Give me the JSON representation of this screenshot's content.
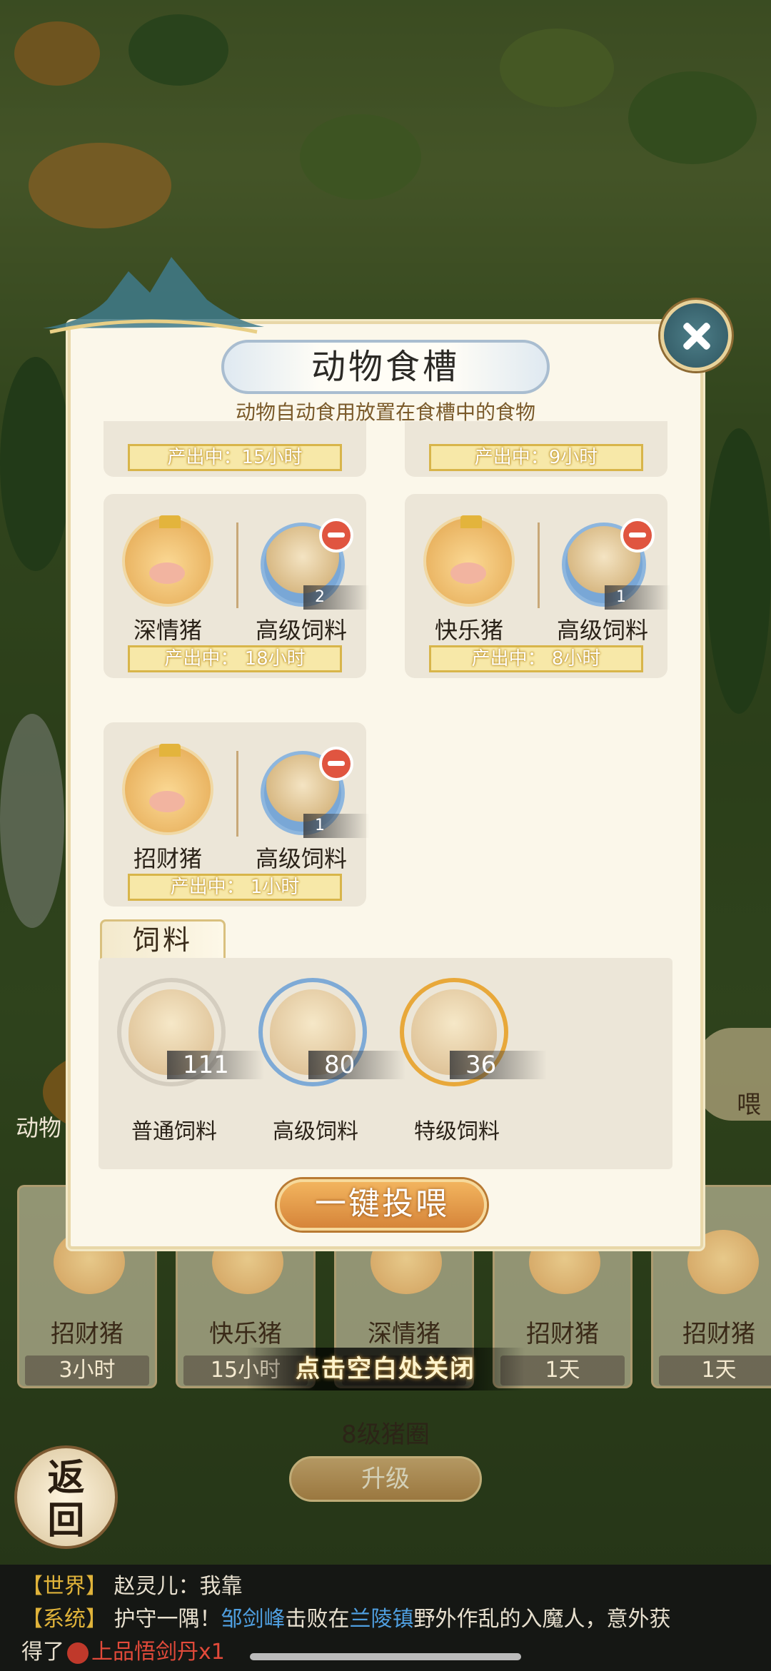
{
  "modal": {
    "title": "动物食槽",
    "subtitle": "动物自动食用放置在食槽中的食物",
    "partial_row": {
      "left_prod": "产出中：15小时",
      "right_prod": "产出中：9小时"
    },
    "troughs": [
      {
        "animal": "深情猪",
        "food": "高级饲料",
        "count": "2",
        "production": "产出中： 18小时"
      },
      {
        "animal": "快乐猪",
        "food": "高级饲料",
        "count": "1",
        "production": "产出中： 8小时"
      },
      {
        "animal": "招财猪",
        "food": "高级饲料",
        "count": "1",
        "production": "产出中： 1小时"
      }
    ],
    "feed_section_label": "饲料",
    "feeds": [
      {
        "name": "普通饲料",
        "count": "111"
      },
      {
        "name": "高级饲料",
        "count": "80"
      },
      {
        "name": "特级饲料",
        "count": "36"
      }
    ],
    "feed_all_label": "一键投喂"
  },
  "background": {
    "animals": [
      {
        "name": "招财猪",
        "time": "3小时"
      },
      {
        "name": "快乐猪",
        "time": "15小时"
      },
      {
        "name": "深情猪",
        "time": ""
      },
      {
        "name": "招财猪",
        "time": "1天"
      },
      {
        "name": "招财猪",
        "time": "1天"
      }
    ],
    "close_hint": "点击空白处关闭",
    "pen_level": "8级猪圈",
    "upgrade_label": "升级",
    "back_label": "返回",
    "side_text": "动物",
    "side_btn_text": "喂"
  },
  "chat": {
    "line1_tag": "【世界】",
    "line1_text": "赵灵儿：我靠",
    "line2_tag": "【系统】",
    "line2_a": "护守一隅！",
    "line2_name": "邹剑峰",
    "line2_b": "击败在",
    "line2_place": "兰陵镇",
    "line2_c": "野外作乱的入魔人，意外获",
    "line3_a": "得了",
    "line3_item": "上品悟剑丹x1"
  },
  "colors": {
    "accent": "#d6853a",
    "modal_bg": "#fbf7ea",
    "chat_tag": "#e0b33a"
  }
}
